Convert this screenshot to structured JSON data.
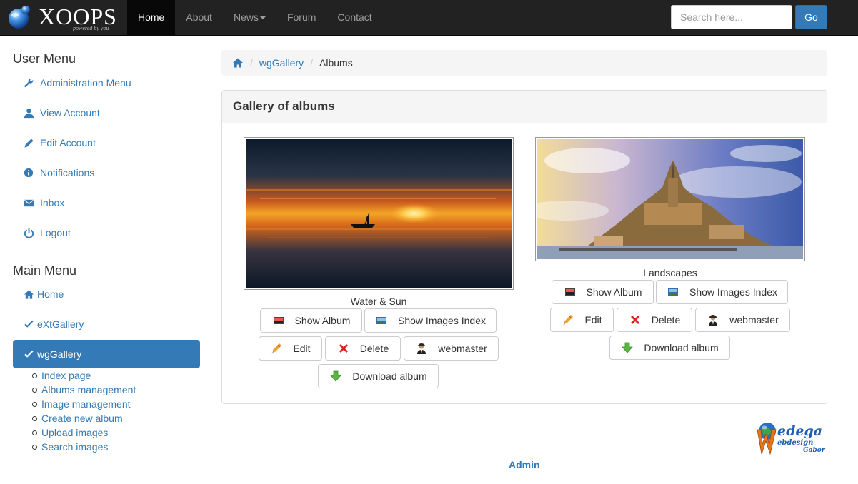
{
  "brand": {
    "name": "XOOPS",
    "tagline": "powered by you"
  },
  "nav": {
    "items": [
      {
        "label": "Home",
        "active": true
      },
      {
        "label": "About"
      },
      {
        "label": "News"
      },
      {
        "label": "Forum"
      },
      {
        "label": "Contact"
      }
    ]
  },
  "search": {
    "placeholder": "Search here...",
    "button_label": "Go"
  },
  "user_menu": {
    "title": "User Menu",
    "items": [
      {
        "label": "Administration Menu",
        "icon": "wrench-icon"
      },
      {
        "label": "View Account",
        "icon": "user-icon"
      },
      {
        "label": "Edit Account",
        "icon": "pencil-icon"
      },
      {
        "label": "Notifications",
        "icon": "info-icon"
      },
      {
        "label": "Inbox",
        "icon": "envelope-icon"
      },
      {
        "label": "Logout",
        "icon": "power-icon"
      }
    ]
  },
  "main_menu": {
    "title": "Main Menu",
    "items": [
      {
        "label": "Home",
        "icon": "home-icon"
      },
      {
        "label": "eXtGallery",
        "icon": "check-icon"
      },
      {
        "label": "wgGallery",
        "icon": "check-icon",
        "active": true
      }
    ],
    "submenu": [
      "Index page",
      "Albums management",
      "Image management",
      "Create new album",
      "Upload images",
      "Search images"
    ]
  },
  "breadcrumb": {
    "items": [
      "wgGallery",
      "Albums"
    ]
  },
  "panel": {
    "title": "Gallery of albums"
  },
  "albums": [
    {
      "name": "Water & Sun",
      "buttons": {
        "show_album": "Show Album",
        "show_index": "Show Images Index",
        "edit": "Edit",
        "delete": "Delete",
        "owner": "webmaster",
        "download": "Download album"
      }
    },
    {
      "name": "Landscapes",
      "buttons": {
        "show_album": "Show Album",
        "show_index": "Show Images Index",
        "edit": "Edit",
        "delete": "Delete",
        "owner": "webmaster",
        "download": "Download album"
      }
    }
  ],
  "footer": {
    "admin_link": "Admin",
    "logo_text": "Wedega webdesign Gabor"
  },
  "colors": {
    "navbar": "#222222",
    "primary": "#337ab7",
    "panel_head": "#f5f5f5"
  }
}
